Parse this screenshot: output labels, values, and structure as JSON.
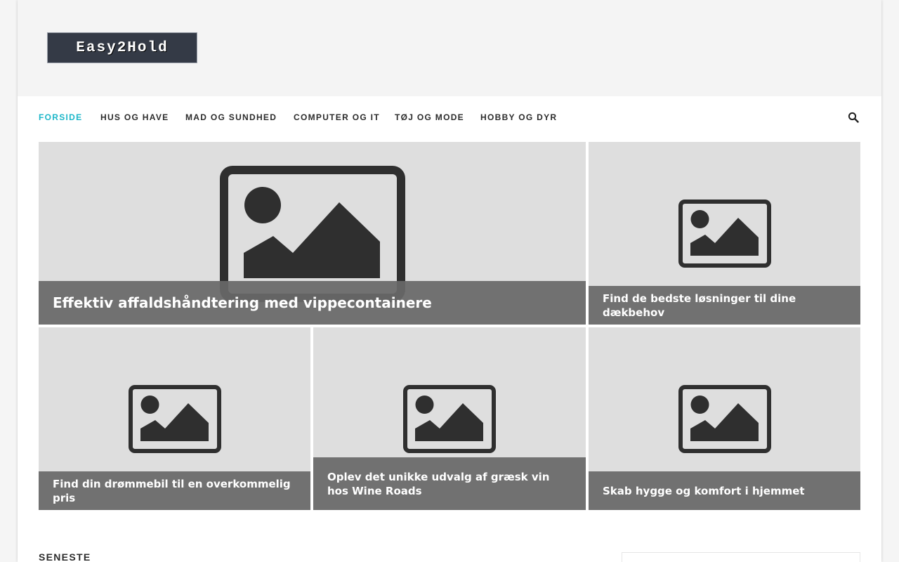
{
  "site": {
    "logo_text": "Easy2Hold"
  },
  "nav": {
    "items": [
      {
        "label": "FORSIDE",
        "active": true
      },
      {
        "label": "HUS OG HAVE",
        "active": false
      },
      {
        "label": "MAD OG SUNDHED",
        "active": false
      },
      {
        "label": "COMPUTER OG IT",
        "active": false
      },
      {
        "label": "TØJ OG MODE",
        "active": false
      },
      {
        "label": "HOBBY OG DYR",
        "active": false
      }
    ],
    "search_icon": "search-icon"
  },
  "featured": [
    {
      "title": "Effektiv affaldshåndtering med vippecontainere",
      "image_icon": "image-placeholder-icon"
    },
    {
      "title": "Find de bedste løsninger til dine dækbehov",
      "image_icon": "image-placeholder-icon"
    },
    {
      "title": "Find din drømmebil til en overkommelig pris",
      "image_icon": "image-placeholder-icon"
    },
    {
      "title": "Oplev det unikke udvalg af græsk vin hos Wine Roads",
      "image_icon": "image-placeholder-icon"
    },
    {
      "title": "Skab hygge og komfort i hjemmet",
      "image_icon": "image-placeholder-icon"
    }
  ],
  "sections": {
    "latest_title": "SENESTE"
  },
  "colors": {
    "accent": "#1db7c9",
    "logo_bg": "#343a46",
    "caption_bg": "#686868",
    "tile_bg": "#dedede",
    "placeholder_icon": "#2f2f2f"
  }
}
